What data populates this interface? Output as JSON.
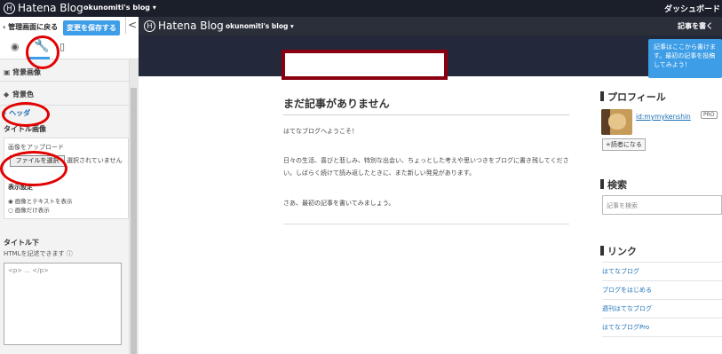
{
  "topbar": {
    "brand": "Hatena Blog",
    "blog_name": "okunomiti's blog",
    "dashboard_label": "ダッシュボード"
  },
  "sidebar": {
    "back_label": "管理画面に戻る",
    "save_label": "変更を保存する",
    "collapse_glyph": "<",
    "items": {
      "bg_image": "背景画像",
      "bg_color": "背景色",
      "header": "ヘッダ",
      "title_image": "タイトル画像"
    },
    "upload": {
      "label": "画像をアップロード",
      "file_button": "ファイルを選択",
      "file_status": "選択されていません",
      "display_setting": "表示設定",
      "option_1": "画像とテキストを表示",
      "option_2": "画像だけ表示"
    },
    "title_below": "タイトル下",
    "html_note": "HTMLを記述できます",
    "html_placeholder": "<p> ... </p>"
  },
  "preview": {
    "brand": "Hatena Blog",
    "blog_name": "okunomiti's blog",
    "write_label": "記事を書く",
    "tooltip": "記事はここから書けます。最初の記事を投稿してみよう！",
    "entry_title": "まだ記事がありません",
    "entry_p1": "はてなブログへようこそ！",
    "entry_p2": "日々の生活、喜びと悲しみ、特別な出会い、ちょっとした考えや思いつきをブログに書き残してください。しばらく続けて読み返したときに、また新しい発見があります。",
    "entry_p3": "さあ、最初の記事を書いてみましょう。",
    "profile_heading": "プロフィール",
    "user_id": "id:mymykenshin",
    "pro_badge": "PRO",
    "reader_button": "+読者になる",
    "search_heading": "検索",
    "search_placeholder": "記事を検索",
    "links_heading": "リンク",
    "links": [
      "はてなブログ",
      "ブログをはじめる",
      "週刊はてなブログ",
      "はてなブログPro"
    ]
  },
  "colors": {
    "accent_blue": "#3d9de6",
    "annotation_red": "#e20000",
    "title_box_border": "#8a0010",
    "header_bg": "#23283a"
  }
}
